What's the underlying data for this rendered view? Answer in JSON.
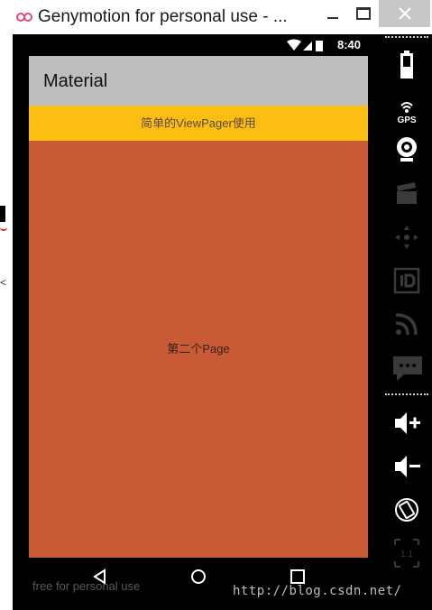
{
  "window": {
    "title": "Genymotion for personal use - ...",
    "buttons": [
      "minimize-icon",
      "maximize-icon",
      "close-icon"
    ]
  },
  "status_bar": {
    "time": "8:40",
    "icons": [
      "wifi-icon",
      "signal-icon",
      "battery-icon"
    ]
  },
  "app": {
    "title": "Material",
    "tab_label": "简单的ViewPager使用",
    "page_text": "第二个Page",
    "colors": {
      "appbar": "#bdbdbd",
      "tabstrip": "#fdbe14",
      "page": "#c85a36"
    }
  },
  "navigation": {
    "buttons": [
      "back-icon",
      "home-icon",
      "recents-icon"
    ]
  },
  "footer": {
    "watermark": "free for personal use"
  },
  "toolbar": {
    "gps_label": "GPS",
    "scale_label": "1:1",
    "icons": [
      "battery-icon",
      "gps-icon",
      "webcam-icon",
      "clapper-icon",
      "dpad-icon",
      "id-icon",
      "rss-icon",
      "sms-icon",
      "volume-up-icon",
      "volume-down-icon",
      "rotate-icon",
      "scale-icon"
    ]
  },
  "overlay": {
    "csdn_url": "http://blog.csdn.net/"
  }
}
